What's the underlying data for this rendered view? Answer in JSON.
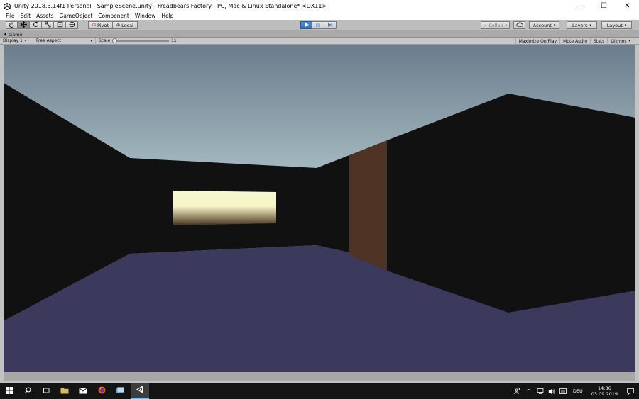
{
  "window": {
    "title": "Unity 2018.3.14f1 Personal - SampleScene.unity - Freadbears Factory - PC, Mac & Linux Standalone* <DX11>",
    "controls": {
      "minimize": "—",
      "maximize": "☐",
      "close": "✕"
    }
  },
  "menu": [
    "File",
    "Edit",
    "Assets",
    "GameObject",
    "Component",
    "Window",
    "Help"
  ],
  "toolbar": {
    "pivot_label": "Pivot",
    "local_label": "Local",
    "collab_label": "Collab",
    "account_label": "Account",
    "layers_label": "Layers",
    "layout_label": "Layout",
    "play_state": "playing"
  },
  "game_tab": {
    "label": "Game"
  },
  "game_toolbar": {
    "display": "Display 1",
    "aspect": "Free Aspect",
    "scale_label": "Scale",
    "scale_value": "1x",
    "maximize_on_play": "Maximize On Play",
    "mute_audio": "Mute Audio",
    "stats": "Stats",
    "gizmos": "Gizmos"
  },
  "taskbar": {
    "language": "DEU",
    "time": "14:36",
    "date": "03.09.2019"
  },
  "colors": {
    "sky_top": "#6b7c8c",
    "sky_bottom": "#bcd3d6",
    "wall": "#111111",
    "floor": "#3c3a5c",
    "pillar": "#4f3324",
    "window_glow": "#f5f7d0",
    "play_accent": "#3d7ecf"
  }
}
